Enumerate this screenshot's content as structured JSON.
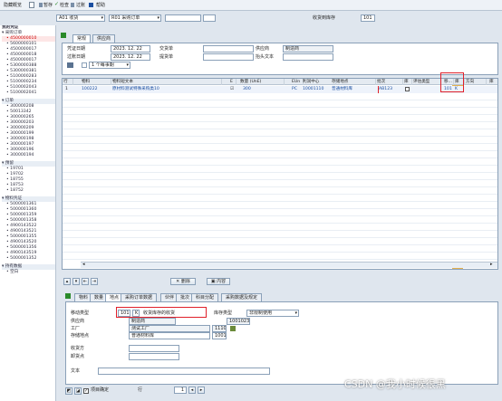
{
  "menu": {
    "items": [
      "隐藏概览",
      "暂存",
      "检查",
      "过账",
      "帮助"
    ]
  },
  "header": {
    "action": "A01 收货",
    "ref_type": "R01 采购订单",
    "movement_label": "收货到库存",
    "movement_code": "101"
  },
  "tree": {
    "section_label": "我的凭证",
    "groups": [
      {
        "label": "采购订单",
        "items": [
          "4500000010",
          "5600000101",
          "4500000017",
          "4500000018",
          "4500000017",
          "5300000388",
          "5300000381",
          "5100000283",
          "5100000234",
          "5100002043",
          "5100002041"
        ],
        "selected": 0
      },
      {
        "label": "订单",
        "items": [
          "300000208",
          "50013342",
          "300000265",
          "300000203",
          "300000209",
          "300000199",
          "300000198",
          "300000197",
          "300000196",
          "300000194"
        ]
      },
      {
        "label": "预留",
        "items": [
          "19701",
          "19702",
          "18755",
          "18753",
          "18752"
        ]
      },
      {
        "label": "物料凭证",
        "items": [
          "5000001361",
          "5000001360",
          "5000001359",
          "5000001358",
          "4900143522",
          "4900143521",
          "5000001355",
          "4900143520",
          "5000001356",
          "4900143519",
          "5000001352"
        ]
      },
      {
        "label": "持有数据",
        "items": [
          "空白"
        ]
      }
    ]
  },
  "doc": {
    "tabs": [
      "常规",
      "供应商"
    ],
    "doc_date_label": "凭证日期",
    "doc_date": "2023. 12. 22",
    "post_date_label": "过账日期",
    "post_date": "2023. 12. 22",
    "delivery_note_label": "交货单",
    "bill_of_lading_label": "提货单",
    "vendor_label": "供应商",
    "vendor_value": "制造商",
    "header_text_label": "抬头文本",
    "slip_option": "1 个每事期"
  },
  "table": {
    "headers": [
      "行",
      "物料",
      "物料短文本",
      "E",
      "数量 (UnE)",
      "EUn",
      "利润中心",
      "存储地点",
      "批次",
      "库",
      "评估类型",
      "移...",
      "库",
      "方向",
      "库"
    ],
    "rows": [
      {
        "line": "1",
        "material": "100222",
        "desc": "原材料测试特殊采购类10",
        "ok": "☑",
        "qty": "300",
        "eun": "PC",
        "profit": "10001110",
        "sloc": "普通材料库",
        "batch": "AB123",
        "mvt": "101",
        "stock": "K"
      }
    ]
  },
  "table_tools": {
    "delete": "删除",
    "content": "内容"
  },
  "detail": {
    "tabs": [
      "物料",
      "数量",
      "地点",
      "采购订单数据",
      "伙伴",
      "批次",
      "科目分配",
      "采购数据及规定"
    ],
    "active_tab": 2,
    "mvt_type_label": "移动类型",
    "mvt_code": "101",
    "mvt_k": "K",
    "mvt_desc": "收货库存的收货",
    "stock_type_label": "库存类型",
    "stock_type_value": "非限制使用",
    "vendor_label": "供应商",
    "vendor_value": "制造商",
    "vendor_code": "1001023",
    "plant_label": "工厂",
    "plant_value": "测试工厂",
    "plant_code": "1110",
    "sloc_label": "存储地点",
    "sloc_value": "普通材料库",
    "sloc_code": "1001",
    "recipient_label": "收货方",
    "unload_label": "卸货点",
    "text_label": "文本",
    "item_ok_label": "项目确定",
    "line_label": "行",
    "line_value": "1"
  },
  "watermark": "CSDN @我小时候很黑",
  "colors": {
    "highlight": "#e6b24d",
    "red": "#e0202a",
    "link": "#1a4ea0"
  }
}
